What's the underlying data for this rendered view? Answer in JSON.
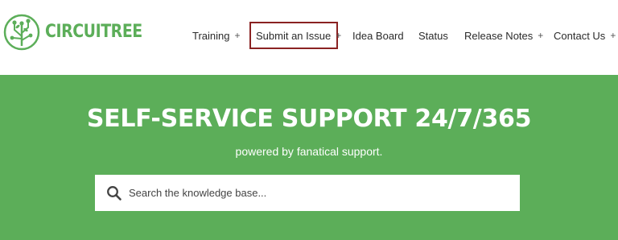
{
  "brand": {
    "name": "CIRCUITREE"
  },
  "nav": {
    "training": "Training",
    "submit_issue": "Submit an Issue",
    "idea_board": "Idea Board",
    "status": "Status",
    "release_notes": "Release Notes",
    "contact_us": "Contact Us",
    "expand_symbol": "+"
  },
  "hero": {
    "title": "SELF-SERVICE SUPPORT 24/7/365",
    "subtitle": "powered by fanatical support."
  },
  "search": {
    "placeholder": "Search the knowledge base..."
  },
  "colors": {
    "brand_green": "#5cae59",
    "highlight_border": "#8a2222"
  }
}
